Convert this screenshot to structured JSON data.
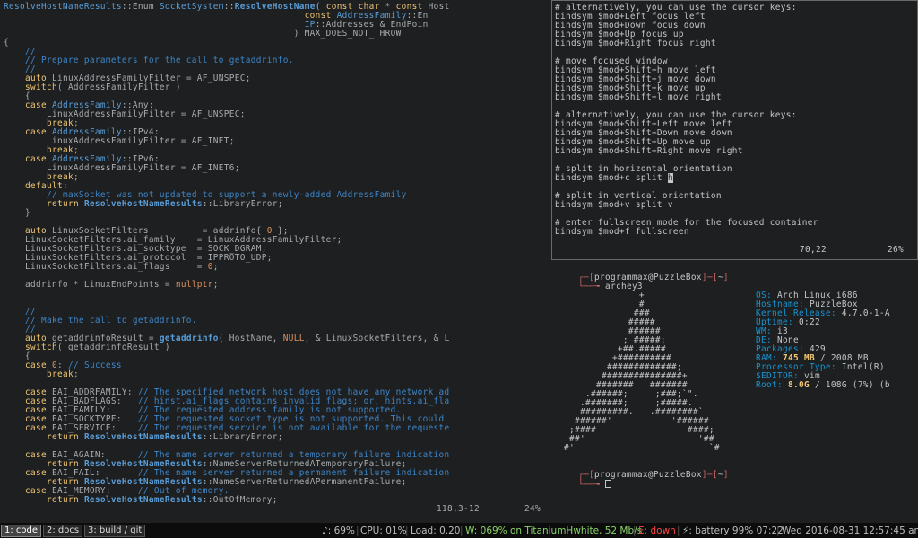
{
  "code_pane": {
    "lines": [
      [
        [
          "ty",
          "ResolveHostNameResults"
        ],
        [
          "",
          "::Enum "
        ],
        [
          "ty",
          "SocketSystem"
        ],
        [
          "",
          "::"
        ],
        [
          "fn",
          "ResolveHostName"
        ],
        [
          "",
          "( "
        ],
        [
          "kw",
          "const char"
        ],
        [
          "",
          " * "
        ],
        [
          "kw",
          "const"
        ],
        [
          "",
          " Host"
        ]
      ],
      [
        [
          "",
          "                                                        "
        ],
        [
          "kw",
          "const "
        ],
        [
          "ty",
          "AddressFamily"
        ],
        [
          "",
          "::En"
        ]
      ],
      [
        [
          "",
          "                                                        "
        ],
        [
          "ty",
          "IP"
        ],
        [
          "",
          "::Addresses & EndPoin"
        ]
      ],
      [
        [
          "",
          "                                                      ) MAX_DOES_NOT_THROW"
        ]
      ],
      [
        [
          "",
          "{"
        ]
      ],
      [
        [
          "",
          "    "
        ],
        [
          "cm",
          "//"
        ]
      ],
      [
        [
          "",
          "    "
        ],
        [
          "cm",
          "// Prepare parameters for the call to getaddrinfo."
        ]
      ],
      [
        [
          "",
          "    "
        ],
        [
          "cm",
          "//"
        ]
      ],
      [
        [
          "",
          "    "
        ],
        [
          "kw",
          "auto"
        ],
        [
          "",
          " LinuxAddressFamilyFilter = AF_UNSPEC;"
        ]
      ],
      [
        [
          "",
          "    "
        ],
        [
          "kw",
          "switch"
        ],
        [
          "",
          "( AddressFamilyFilter )"
        ]
      ],
      [
        [
          "",
          "    {"
        ]
      ],
      [
        [
          "",
          "    "
        ],
        [
          "kw",
          "case "
        ],
        [
          "ty",
          "AddressFamily"
        ],
        [
          "",
          "::Any:"
        ]
      ],
      [
        [
          "",
          "        LinuxAddressFamilyFilter = AF_UNSPEC;"
        ]
      ],
      [
        [
          "",
          "        "
        ],
        [
          "kw",
          "break"
        ],
        [
          "",
          ";"
        ]
      ],
      [
        [
          "",
          "    "
        ],
        [
          "kw",
          "case "
        ],
        [
          "ty",
          "AddressFamily"
        ],
        [
          "",
          "::IPv4:"
        ]
      ],
      [
        [
          "",
          "        LinuxAddressFamilyFilter = AF_INET;"
        ]
      ],
      [
        [
          "",
          "        "
        ],
        [
          "kw",
          "break"
        ],
        [
          "",
          ";"
        ]
      ],
      [
        [
          "",
          "    "
        ],
        [
          "kw",
          "case "
        ],
        [
          "ty",
          "AddressFamily"
        ],
        [
          "",
          "::IPv6:"
        ]
      ],
      [
        [
          "",
          "        LinuxAddressFamilyFilter = AF_INET6;"
        ]
      ],
      [
        [
          "",
          "        "
        ],
        [
          "kw",
          "break"
        ],
        [
          "",
          ";"
        ]
      ],
      [
        [
          "",
          "    "
        ],
        [
          "kw",
          "default"
        ],
        [
          "",
          ":"
        ]
      ],
      [
        [
          "",
          "        "
        ],
        [
          "cm",
          "// maxSocket was not updated to support a newly-added AddressFamily"
        ]
      ],
      [
        [
          "",
          "        "
        ],
        [
          "kw",
          "return "
        ],
        [
          "fn",
          "ResolveHostNameResults"
        ],
        [
          "",
          "::LibraryError;"
        ]
      ],
      [
        [
          "",
          "    }"
        ]
      ],
      [
        [
          "",
          ""
        ]
      ],
      [
        [
          "",
          "    "
        ],
        [
          "kw",
          "auto"
        ],
        [
          "",
          " LinuxSocketFilters          = addrinfo{ "
        ],
        [
          "nm",
          "0"
        ],
        [
          "",
          " };"
        ]
      ],
      [
        [
          "",
          "    LinuxSocketFilters.ai_family    = LinuxAddressFamilyFilter;"
        ]
      ],
      [
        [
          "",
          "    LinuxSocketFilters.ai_socktype  = SOCK_DGRAM;"
        ]
      ],
      [
        [
          "",
          "    LinuxSocketFilters.ai_protocol  = IPPROTO_UDP;"
        ]
      ],
      [
        [
          "",
          "    LinuxSocketFilters.ai_flags     = "
        ],
        [
          "nm",
          "0"
        ],
        [
          "",
          ";"
        ]
      ],
      [
        [
          "",
          ""
        ]
      ],
      [
        [
          "",
          "    addrinfo * LinuxEndPoints = "
        ],
        [
          "nm",
          "nullptr"
        ],
        [
          "",
          ";"
        ]
      ],
      [
        [
          "",
          ""
        ]
      ],
      [
        [
          "",
          ""
        ]
      ],
      [
        [
          "",
          "    "
        ],
        [
          "cm",
          "//"
        ]
      ],
      [
        [
          "",
          "    "
        ],
        [
          "cm",
          "// Make the call to getaddrinfo."
        ]
      ],
      [
        [
          "",
          "    "
        ],
        [
          "cm",
          "//"
        ]
      ],
      [
        [
          "",
          "    "
        ],
        [
          "kw",
          "auto"
        ],
        [
          "",
          " getaddrinfoResult = "
        ],
        [
          "fn",
          "getaddrinfo"
        ],
        [
          "",
          "( HostName, "
        ],
        [
          "nm",
          "NULL"
        ],
        [
          "",
          ", & LinuxSocketFilters, & L"
        ]
      ],
      [
        [
          "",
          "    "
        ],
        [
          "kw",
          "switch"
        ],
        [
          "",
          "( getaddrinfoResult )"
        ]
      ],
      [
        [
          "",
          "    {"
        ]
      ],
      [
        [
          "",
          "    "
        ],
        [
          "kw",
          "case "
        ],
        [
          "nm",
          "0"
        ],
        [
          "",
          ": "
        ],
        [
          "cm",
          "// Success"
        ]
      ],
      [
        [
          "",
          "        "
        ],
        [
          "kw",
          "break"
        ],
        [
          "",
          ";"
        ]
      ],
      [
        [
          "",
          ""
        ]
      ],
      [
        [
          "",
          "    "
        ],
        [
          "kw",
          "case"
        ],
        [
          "",
          " EAI_ADDRFAMILY: "
        ],
        [
          "cm",
          "// The specified network host does not have any network ad"
        ]
      ],
      [
        [
          "",
          "    "
        ],
        [
          "kw",
          "case"
        ],
        [
          "",
          " EAI_BADFLAGS:   "
        ],
        [
          "cm",
          "// hinst.ai_flags contains invalid flags; or, hints.ai_fla"
        ]
      ],
      [
        [
          "",
          "    "
        ],
        [
          "kw",
          "case"
        ],
        [
          "",
          " EAI_FAMILY:     "
        ],
        [
          "cm",
          "// The requested address family is not supported."
        ]
      ],
      [
        [
          "",
          "    "
        ],
        [
          "kw",
          "case"
        ],
        [
          "",
          " EAI_SOCKTYPE:   "
        ],
        [
          "cm",
          "// The requested socket type is not supported. This could"
        ]
      ],
      [
        [
          "",
          "    "
        ],
        [
          "kw",
          "case"
        ],
        [
          "",
          " EAI_SERVICE:    "
        ],
        [
          "cm",
          "// The requested service is not available for the requeste"
        ]
      ],
      [
        [
          "",
          "        "
        ],
        [
          "kw",
          "return "
        ],
        [
          "fn",
          "ResolveHostNameResults"
        ],
        [
          "",
          "::LibraryError;"
        ]
      ],
      [
        [
          "",
          ""
        ]
      ],
      [
        [
          "",
          "    "
        ],
        [
          "kw",
          "case"
        ],
        [
          "",
          " EAI_AGAIN:      "
        ],
        [
          "cm",
          "// The name server returned a temporary failure indication"
        ]
      ],
      [
        [
          "",
          "        "
        ],
        [
          "kw",
          "return "
        ],
        [
          "fn",
          "ResolveHostNameResults"
        ],
        [
          "",
          "::NameServerReturnedATemporaryFailure;"
        ]
      ],
      [
        [
          "",
          "    "
        ],
        [
          "kw",
          "case"
        ],
        [
          "",
          " EAI_FAIL:       "
        ],
        [
          "cm",
          "// The name server returned a permanent failure indication"
        ]
      ],
      [
        [
          "",
          "        "
        ],
        [
          "kw",
          "return "
        ],
        [
          "fn",
          "ResolveHostNameResults"
        ],
        [
          "",
          "::NameServerReturnedAPermanentFailure;"
        ]
      ],
      [
        [
          "",
          "    "
        ],
        [
          "kw",
          "case"
        ],
        [
          "",
          " EAI_MEMORY:     "
        ],
        [
          "cm",
          "// Out of memory."
        ]
      ],
      [
        [
          "",
          "        "
        ],
        [
          "kw",
          "return "
        ],
        [
          "fn",
          "ResolveHostNameResults"
        ],
        [
          "",
          "::OutOfMemory;"
        ]
      ]
    ],
    "status_position": "118,3-12",
    "status_percent": "24%"
  },
  "editor_pane": {
    "lines": [
      "# alternatively, you can use the cursor keys:",
      "bindsym $mod+Left focus left",
      "bindsym $mod+Down focus down",
      "bindsym $mod+Up focus up",
      "bindsym $mod+Right focus right",
      "",
      "# move focused window",
      "bindsym $mod+Shift+h move left",
      "bindsym $mod+Shift+j move down",
      "bindsym $mod+Shift+k move up",
      "bindsym $mod+Shift+l move right",
      "",
      "# alternatively, you can use the cursor keys:",
      "bindsym $mod+Shift+Left move left",
      "bindsym $mod+Shift+Down move down",
      "bindsym $mod+Shift+Up move up",
      "bindsym $mod+Shift+Right move right",
      "",
      "# split in horizontal orientation",
      "bindsym $mod+c split ",
      "",
      "# split in vertical orientation",
      "bindsym $mod+v split v",
      "",
      "# enter fullscreen mode for the focused container",
      "bindsym $mod+f fullscreen"
    ],
    "cursor_char": "h",
    "status_position": "70,22",
    "status_percent": "26%"
  },
  "terminal_pane": {
    "prompt_user": "programmax",
    "prompt_at": "@",
    "prompt_host": "PuzzleBox",
    "prompt_dir": "~",
    "command": "archey3",
    "art_lines": [
      "               +",
      "               #",
      "              ###",
      "             #####",
      "             ######",
      "            ; #####;",
      "           +##.#####",
      "          +##########",
      "         #############;",
      "        ###############+",
      "       #######   #######",
      "     .######;     ;###;`\".",
      "    .#######;     ;#####.",
      "    #########.   .########`",
      "   ######'           '######",
      "  ;####                 ####;",
      "  ##'                     '##",
      " #'                         `#"
    ],
    "info": [
      {
        "label": "OS:",
        "value": "Arch Linux i686"
      },
      {
        "label": "Hostname:",
        "value": "PuzzleBox"
      },
      {
        "label": "Kernel Release:",
        "value": "4.7.0-1-A"
      },
      {
        "label": "Uptime:",
        "value": "0:22"
      },
      {
        "label": "WM:",
        "value": "i3"
      },
      {
        "label": "DE:",
        "value": "None"
      },
      {
        "label": "Packages:",
        "value": "429"
      },
      {
        "label": "RAM:",
        "value_hl": "745 MB",
        "value": " / 2008 MB"
      },
      {
        "label": "Processor Type:",
        "value": "Intel(R)"
      },
      {
        "label": "$EDITOR:",
        "value": "vim"
      },
      {
        "label": "Root:",
        "value_hl": "8.0G",
        "value": " / 108G (7%) (b"
      }
    ]
  },
  "bar": {
    "workspaces": [
      "1: code",
      "2: docs",
      "3: build / git"
    ],
    "volume": "♪: 69%",
    "cpu": "CPU: 01%",
    "load": "Load: 0.20",
    "wireless": "W: 069% on TitaniumHwhite, 52 Mb/s",
    "ethernet": "E: down",
    "battery": "⚡: battery 99% 07:22",
    "datetime": "Wed 2016-08-31  12:57:45 am",
    "colors": {
      "wireless": "#8bd36b",
      "ethernet": "#ff4444",
      "focused_ws": "#444444"
    }
  }
}
